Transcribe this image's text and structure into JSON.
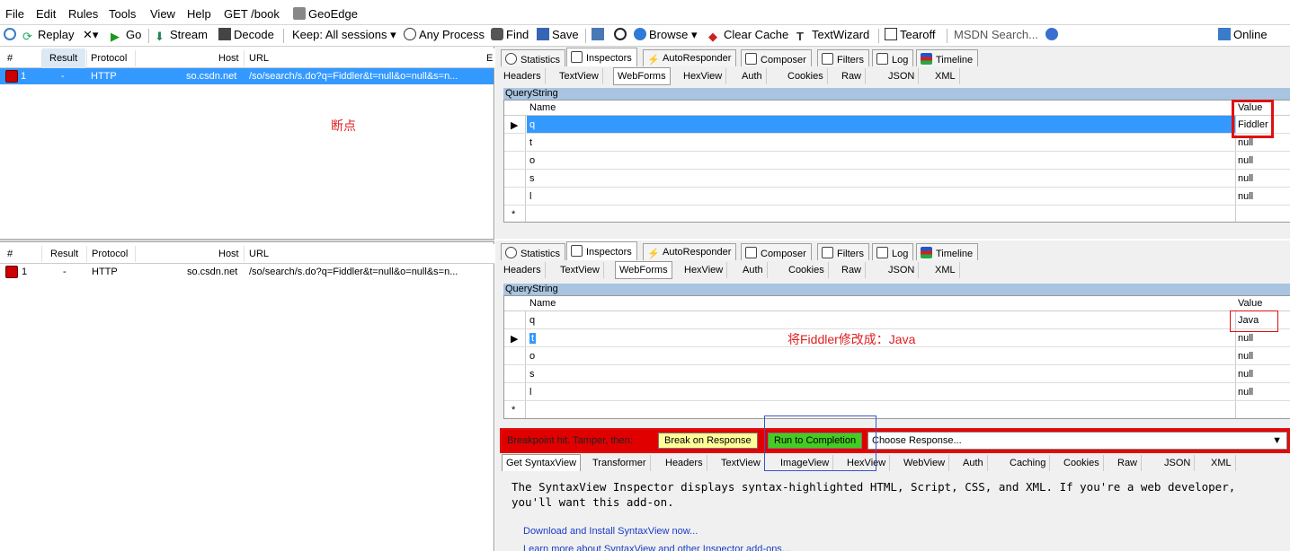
{
  "menu": [
    "File",
    "Edit",
    "Rules",
    "Tools",
    "View",
    "Help",
    "GET /book",
    "GeoEdge"
  ],
  "toolbar": {
    "replay": "Replay",
    "go": "Go",
    "stream": "Stream",
    "decode": "Decode",
    "keep": "Keep: All sessions",
    "process": "Any Process",
    "find": "Find",
    "save": "Save",
    "browse": "Browse",
    "clear_cache": "Clear Cache",
    "textwizard": "TextWizard",
    "tearoff": "Tearoff",
    "msdn": "MSDN Search...",
    "online": "Online"
  },
  "sessions": {
    "headers": [
      "#",
      "Result",
      "Protocol",
      "Host",
      "URL"
    ],
    "row": {
      "num": "1",
      "result": "-",
      "protocol": "HTTP",
      "host": "so.csdn.net",
      "url": "/so/search/s.do?q=Fiddler&t=null&o=null&s=n..."
    },
    "annotation_top": "断点"
  },
  "inspector_tabs": [
    "Statistics",
    "Inspectors",
    "AutoResponder",
    "Composer",
    "Filters",
    "Log",
    "Timeline"
  ],
  "request_tabs": [
    "Headers",
    "TextView",
    "WebForms",
    "HexView",
    "Auth",
    "Cookies",
    "Raw",
    "JSON",
    "XML"
  ],
  "querystring": {
    "label": "QueryString",
    "col_name": "Name",
    "col_value": "Value",
    "top_rows": [
      {
        "name": "q",
        "value": "Fiddler"
      },
      {
        "name": "t",
        "value": "null"
      },
      {
        "name": "o",
        "value": "null"
      },
      {
        "name": "s",
        "value": "null"
      },
      {
        "name": "l",
        "value": "null"
      }
    ],
    "bottom_rows": [
      {
        "name": "q",
        "value": "Java"
      },
      {
        "name": "t",
        "value": "null"
      },
      {
        "name": "o",
        "value": "null"
      },
      {
        "name": "s",
        "value": "null"
      },
      {
        "name": "l",
        "value": "null"
      }
    ],
    "new_row_marker": "*"
  },
  "annotation_bottom": "将Fiddler修改成：Java",
  "breakpoint": {
    "label": "Breakpoint hit. Tamper, then:",
    "break_on_response": "Break on Response",
    "run_to_completion": "Run to Completion",
    "choose_response": "Choose Response..."
  },
  "response_tabs": [
    "Get SyntaxView",
    "Transformer",
    "Headers",
    "TextView",
    "ImageView",
    "HexView",
    "WebView",
    "Auth",
    "Caching",
    "Cookies",
    "Raw",
    "JSON",
    "XML"
  ],
  "syntax": {
    "text": "The SyntaxView Inspector displays syntax-highlighted HTML, Script, CSS, and XML. If you're a web developer, you'll want this add-on.",
    "link1": "Download and Install SyntaxView now...",
    "link2": "Learn more about SyntaxView and other Inspector add-ons..."
  },
  "colors": {
    "breakpoint_bar": "#e00000",
    "selection": "#3399ff",
    "annotation": "#e02020"
  }
}
